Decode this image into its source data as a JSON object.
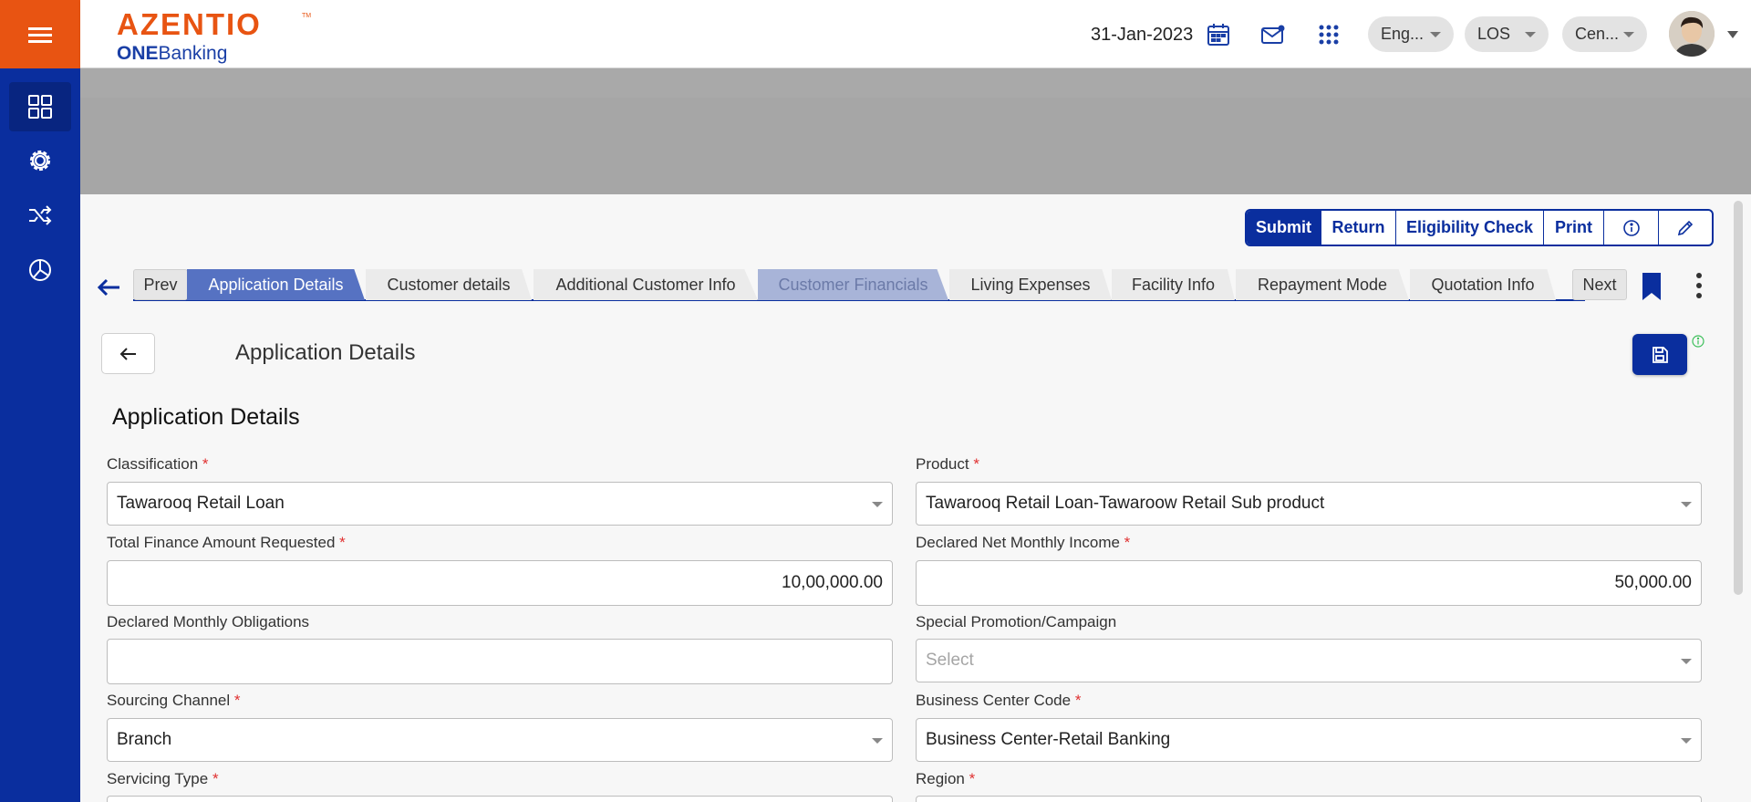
{
  "header": {
    "logo_main": "AZENTIO",
    "logo_tm": "TM",
    "logo_sub_bold": "ONE",
    "logo_sub_rest": "Banking",
    "date": "31-Jan-2023",
    "language": "Eng...",
    "module": "LOS",
    "center": "Cen..."
  },
  "actions": {
    "submit": "Submit",
    "return": "Return",
    "eligibility": "Eligibility Check",
    "print": "Print"
  },
  "tabs": {
    "prev": "Prev",
    "next": "Next",
    "items": [
      {
        "label": "Application Details",
        "state": "active"
      },
      {
        "label": "Customer details",
        "state": "normal"
      },
      {
        "label": "Additional Customer Info",
        "state": "normal"
      },
      {
        "label": "Customer Financials",
        "state": "disabled"
      },
      {
        "label": "Living Expenses",
        "state": "normal"
      },
      {
        "label": "Facility Info",
        "state": "normal"
      },
      {
        "label": "Repayment Mode",
        "state": "normal"
      },
      {
        "label": "Quotation Info",
        "state": "normal"
      }
    ]
  },
  "page": {
    "title": "Application Details",
    "section_title": "Application Details"
  },
  "form": {
    "classification": {
      "label": "Classification",
      "value": "Tawarooq Retail Loan"
    },
    "product": {
      "label": "Product",
      "value": "Tawarooq Retail Loan-Tawaroow Retail Sub product"
    },
    "total_finance": {
      "label": "Total Finance Amount Requested",
      "value": "10,00,000.00"
    },
    "net_income": {
      "label": "Declared Net Monthly Income",
      "value": "50,000.00"
    },
    "obligations": {
      "label": "Declared Monthly Obligations",
      "value": ""
    },
    "promotion": {
      "label": "Special Promotion/Campaign",
      "placeholder": "Select"
    },
    "sourcing": {
      "label": "Sourcing Channel",
      "value": "Branch"
    },
    "business_center": {
      "label": "Business Center Code",
      "value": "Business Center-Retail Banking"
    },
    "servicing": {
      "label": "Servicing Type"
    },
    "region": {
      "label": "Region"
    },
    "required_mark": "*"
  },
  "colors": {
    "sidebar": "#0a2e9e",
    "brand_orange": "#e85412",
    "active_tab": "#5672c2",
    "required": "#e03131"
  },
  "icons": {
    "menu": "hamburger-icon",
    "dashboard": "grid-icon",
    "settings": "gear-icon",
    "workflow": "shuffle-icon",
    "reports": "pie-chart-icon",
    "calendar": "calendar-icon",
    "mail": "mail-icon",
    "apps": "apps-grid-icon",
    "save": "floppy-icon"
  }
}
